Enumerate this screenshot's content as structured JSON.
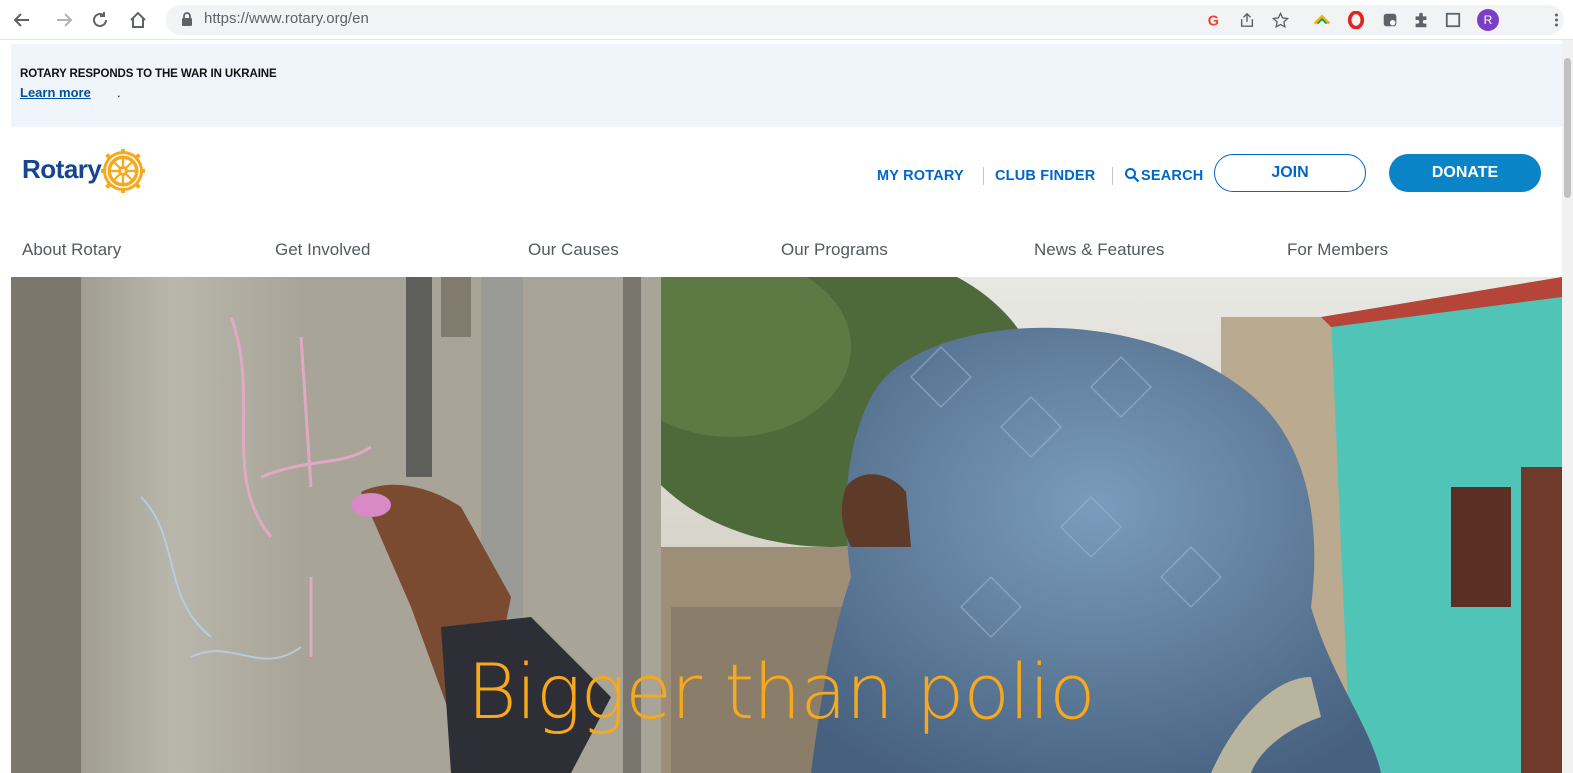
{
  "browser": {
    "url": "https://www.rotary.org/en",
    "profile_initial": "R"
  },
  "alert": {
    "title": "ROTARY RESPONDS TO THE WAR IN UKRAINE",
    "link": "Learn more",
    "punct": "."
  },
  "header": {
    "logo_text": "Rotary",
    "util_links": [
      "MY ROTARY",
      "CLUB FINDER",
      "SEARCH"
    ],
    "join_label": "JOIN",
    "donate_label": "DONATE"
  },
  "mainnav": [
    "About Rotary",
    "Get Involved",
    "Our Causes",
    "Our Programs",
    "News & Features",
    "For Members"
  ],
  "hero": {
    "title": "Bigger than polio"
  },
  "colors": {
    "brand_blue": "#17458f",
    "link_blue": "#0067c8",
    "donate_blue": "#0a84c7",
    "gold": "#f7a81b"
  }
}
